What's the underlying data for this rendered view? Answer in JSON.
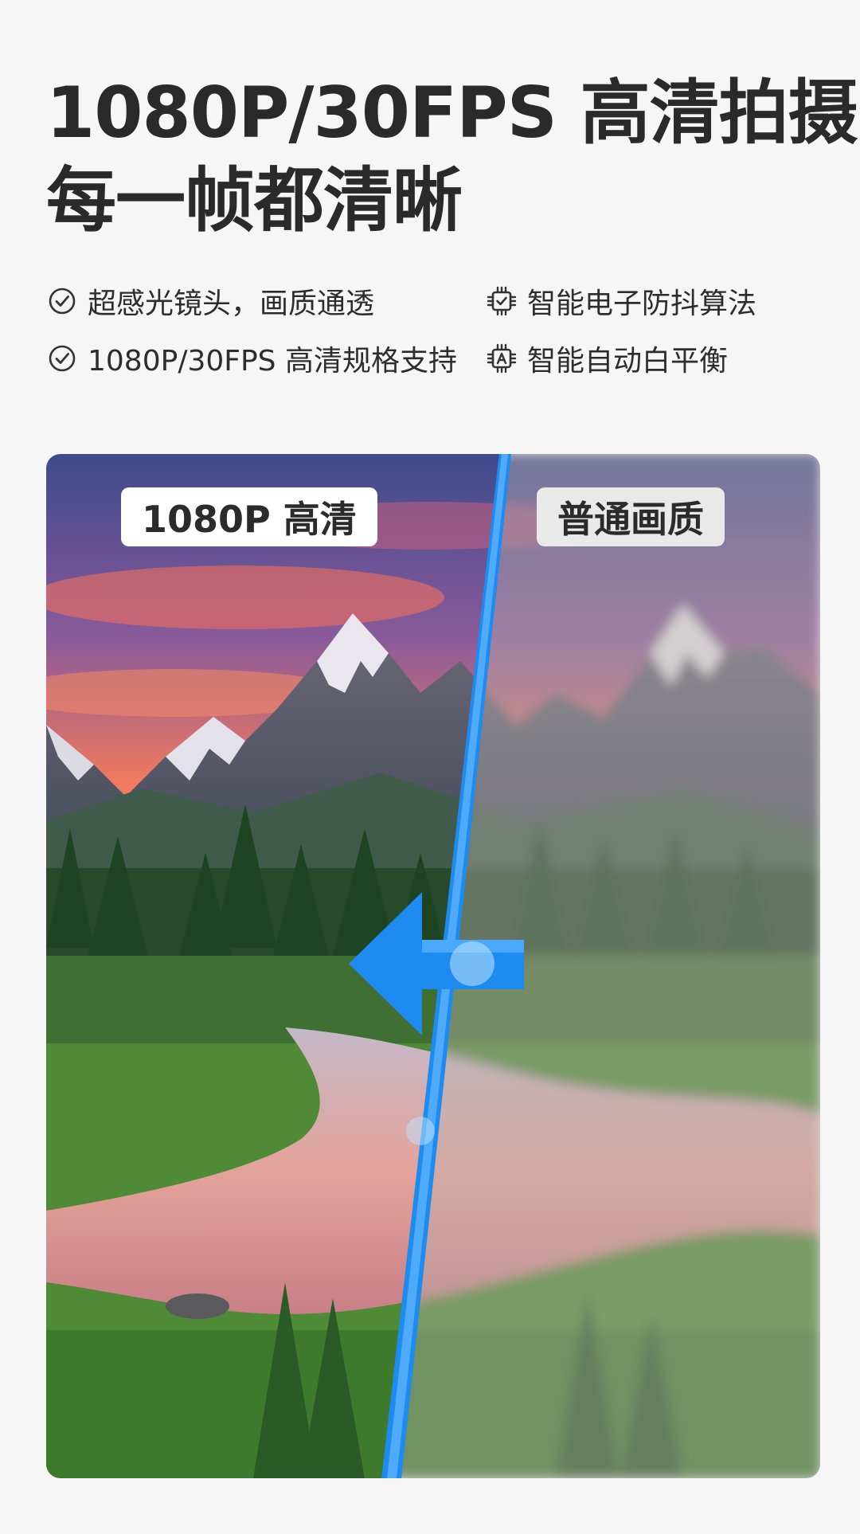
{
  "headline": {
    "line1": "1080P/30FPS 高清拍摄",
    "line2": "每一帧都清晰"
  },
  "features": [
    {
      "icon": "check-circle-icon",
      "label": "超感光镜头，画质通透"
    },
    {
      "icon": "chip-check-icon",
      "label": "智能电子防抖算法"
    },
    {
      "icon": "check-circle-icon",
      "label": "1080P/30FPS 高清规格支持"
    },
    {
      "icon": "chip-a-icon",
      "label": "智能自动白平衡"
    }
  ],
  "comparison": {
    "left_label": "1080P 高清",
    "right_label": "普通画质",
    "accent_color": "#1e8bf0"
  }
}
